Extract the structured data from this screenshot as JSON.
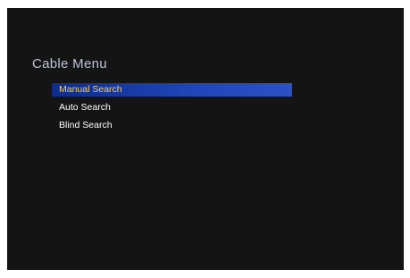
{
  "menu": {
    "title": "Cable Menu",
    "items": [
      {
        "label": "Manual Search",
        "selected": true
      },
      {
        "label": "Auto Search",
        "selected": false
      },
      {
        "label": "Blind Search",
        "selected": false
      }
    ]
  },
  "colors": {
    "screen_background": "#141414",
    "title_text": "#b9c2d6",
    "item_text": "#ffffff",
    "selected_highlight": "#1f46b9",
    "selected_text": "#ffd24a"
  }
}
